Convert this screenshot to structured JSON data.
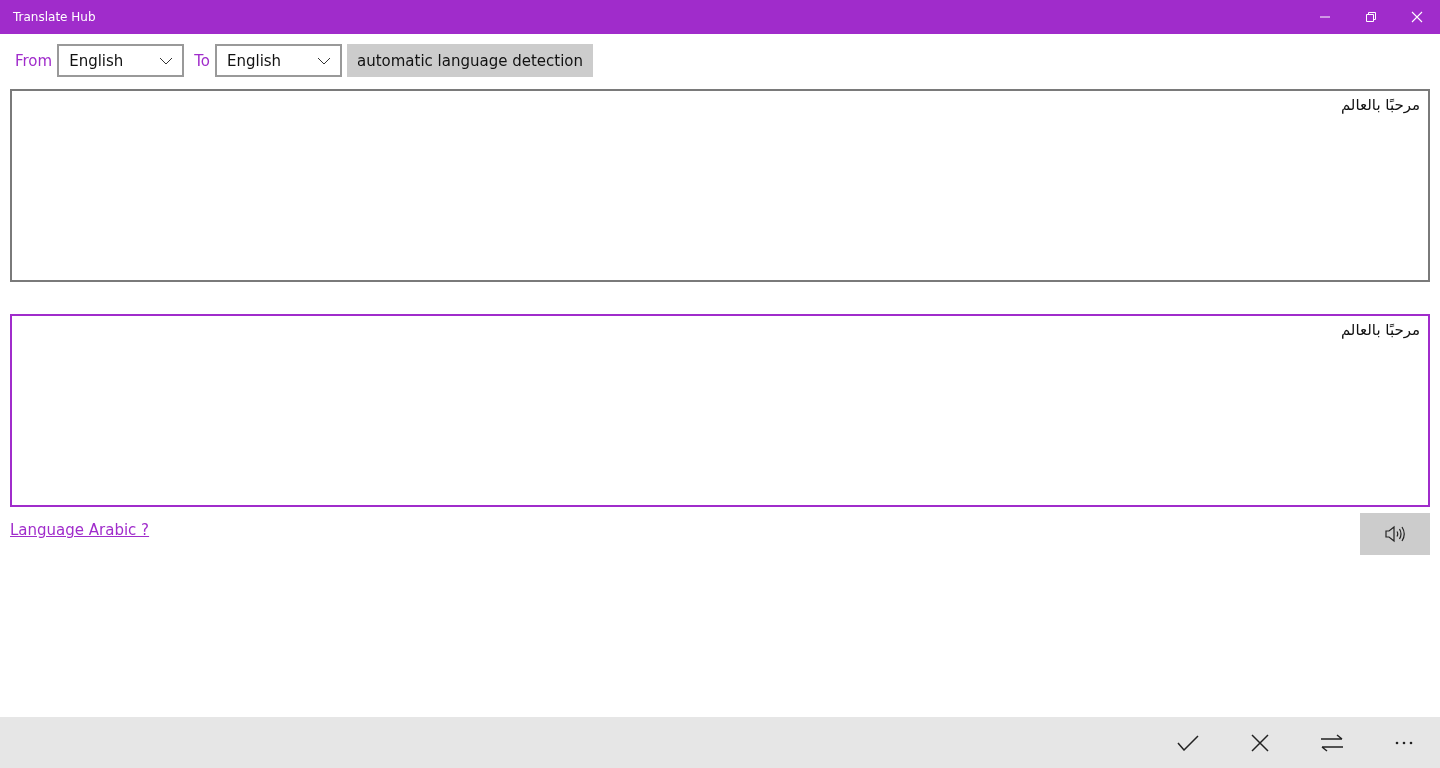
{
  "window": {
    "title": "Translate Hub"
  },
  "languages": {
    "from_label": "From",
    "from_value": "English",
    "to_label": "To",
    "to_value": "English",
    "detect_button": "automatic language detection"
  },
  "text_boxes": [
    {
      "value": "مرحبًا بالعالم",
      "focused": false
    },
    {
      "value": "مرحبًا بالعالم",
      "focused": true
    }
  ],
  "detected_link": "Language Arabic ?",
  "command_bar": [
    {
      "kind": "check"
    },
    {
      "kind": "close"
    },
    {
      "kind": "swap"
    },
    {
      "kind": "more"
    }
  ]
}
